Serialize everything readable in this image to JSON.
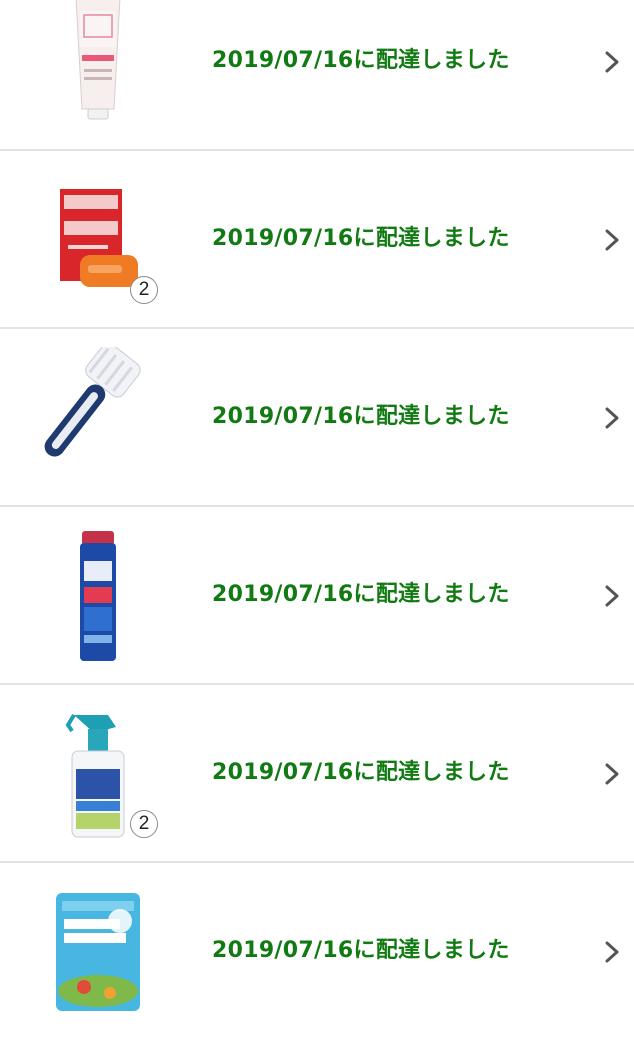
{
  "colors": {
    "status_text": "#127a13",
    "divider": "#e3e3e3",
    "chevron": "#555555"
  },
  "orders": [
    {
      "status": "2019/07/16に配達しました",
      "quantity": null,
      "thumbnail_icon": "face-wash-tube-icon"
    },
    {
      "status": "2019/07/16に配達しました",
      "quantity": "2",
      "thumbnail_icon": "soap-box-icon"
    },
    {
      "status": "2019/07/16に配達しました",
      "quantity": null,
      "thumbnail_icon": "cleaning-brush-icon"
    },
    {
      "status": "2019/07/16に配達しました",
      "quantity": null,
      "thumbnail_icon": "spray-can-icon"
    },
    {
      "status": "2019/07/16に配達しました",
      "quantity": "2",
      "thumbnail_icon": "spray-bottle-icon"
    },
    {
      "status": "2019/07/16に配達しました",
      "quantity": null,
      "thumbnail_icon": "dextrin-bag-icon"
    }
  ]
}
